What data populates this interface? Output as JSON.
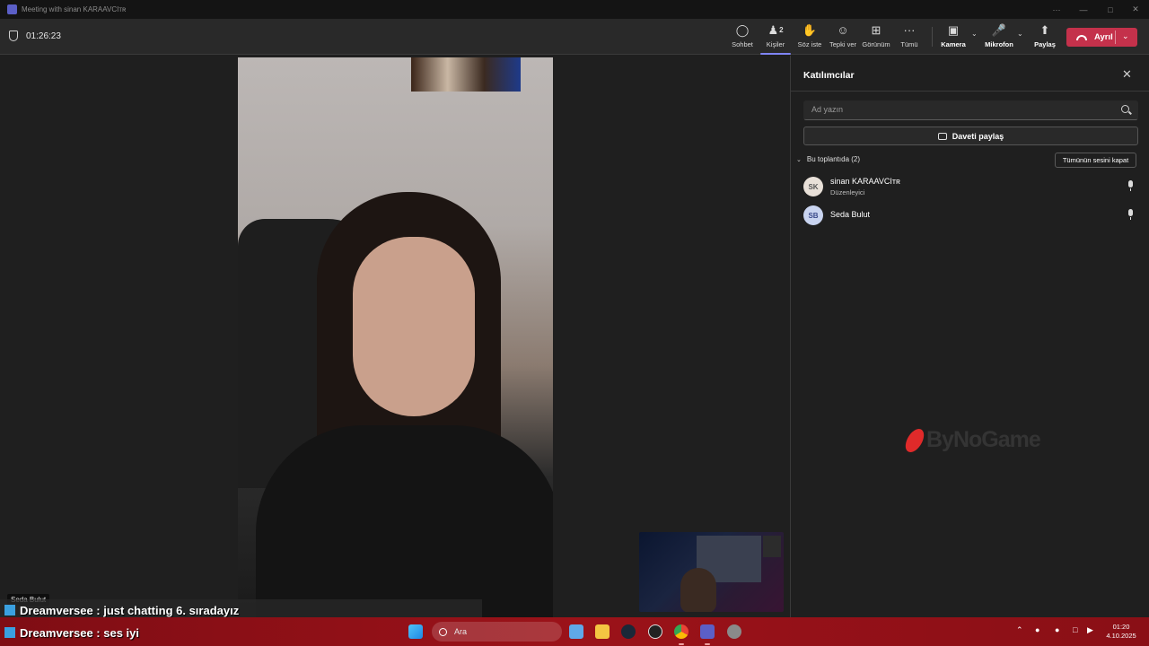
{
  "window": {
    "title": "Meeting with sinan KARAAVCIᴛʀ",
    "min": "—",
    "max": "□",
    "close": "✕",
    "more": "···"
  },
  "toolbar": {
    "timer": "01:26:23",
    "chat_label": "Sohbet",
    "people_label": "Kişiler",
    "people_count": "2",
    "raise_label": "Söz iste",
    "react_label": "Tepki ver",
    "view_label": "Görünüm",
    "more_label": "Tümü",
    "camera_label": "Kamera",
    "mic_label": "Mikrofon",
    "share_label": "Paylaş",
    "leave_label": "Ayrıl"
  },
  "stage": {
    "main_name": "Seda Bulut"
  },
  "panel": {
    "title": "Katılımcılar",
    "search_placeholder": "Ad yazın",
    "invite_label": "Daveti paylaş",
    "section_label": "Bu toplantıda (2)",
    "mute_all_label": "Tümünün sesini kapat",
    "participants": [
      {
        "initials": "SK",
        "name": "sinan KARAAVCIᴛʀ",
        "role": "Düzenleyici",
        "avatar_bg": "#e8e0d8",
        "avatar_fg": "#555555"
      },
      {
        "initials": "SB",
        "name": "Seda Bulut",
        "role": "",
        "avatar_bg": "#c9d4f0",
        "avatar_fg": "#3b4a8a"
      }
    ],
    "watermark": "ByNoGame"
  },
  "chat": [
    "Dreamversee : just chatting 6. sıradayız",
    "Dreamversee : ses iyi"
  ],
  "taskbar": {
    "search_label": "Ara",
    "time": "01:20",
    "date": "4.10.2025"
  },
  "colors": {
    "leave": "#c4314b",
    "accent": "#7f85f5",
    "taskbar": "#9b1219"
  }
}
